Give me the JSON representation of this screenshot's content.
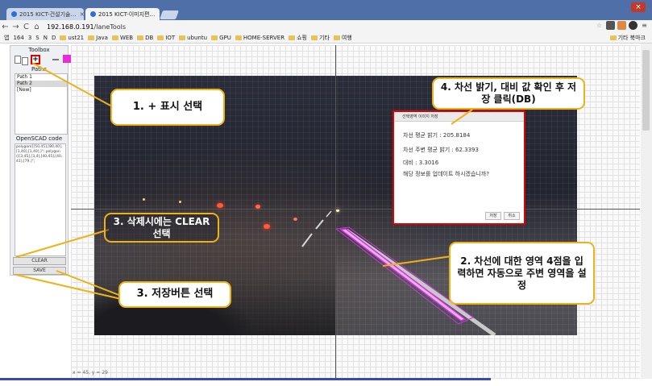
{
  "browser": {
    "tabs": [
      {
        "title": "2015 KICT-건설기술…",
        "active": false
      },
      {
        "title": "2015 KICT-이미지편…",
        "active": true
      }
    ],
    "url_prefix": "192.168.0.191",
    "url_path": "/laneTools",
    "bookmarks": [
      "앱",
      "164",
      "3",
      "S",
      "N",
      "D",
      "ust21",
      "Java",
      "WEB",
      "DB",
      "IOT",
      "ubuntu",
      "GPU",
      "HOME-SERVER",
      "쇼핑",
      "기타",
      "여행"
    ],
    "other_bookmarks": "기타 북마크"
  },
  "toolbox": {
    "title": "Toolbox",
    "plus_symbol": "+",
    "paths_title": "Paths",
    "paths": [
      "Path 1",
      "Path 2",
      "[New]"
    ],
    "openscad_title": "OpenSCAD code",
    "openscad_code": "polygon([[50,45],[80,40],[1,40],[1,40],]\";\npolygon([[3,45],[3,4],[40,45],[40,41],[79,]\";",
    "accent_color": "#e62ed8"
  },
  "buttons": {
    "clear": "CLEAR",
    "save": "SAVE"
  },
  "coords_text": "x = 45, y = 29",
  "dialog": {
    "title": "선택영역 이미지 저장",
    "lines": [
      "차선 평균 밝기 : 205.8184",
      "차선 주변 평균 밝기 : 62.3393",
      "대비 : 3.3016",
      "해당 정보를 업데이트 하시겠습니까?"
    ],
    "ok": "저장",
    "cancel": "취소"
  },
  "callouts": {
    "c1": "1. + 표시 선택",
    "c2": "2.  차선에 대한 영역 4점을 입력하면 자동으로 주변 영역을 설정",
    "c3": "3. 삭제시에는 CLEAR 선택",
    "c3b": "3. 저장버튼 선택",
    "c4": "4. 차선 밝기, 대비 값 확인 후 저장 클릭(DB)"
  },
  "colors": {
    "callout_border": "#f0b117",
    "highlight_red": "#e00000",
    "lane_marker": "#c838d8"
  }
}
